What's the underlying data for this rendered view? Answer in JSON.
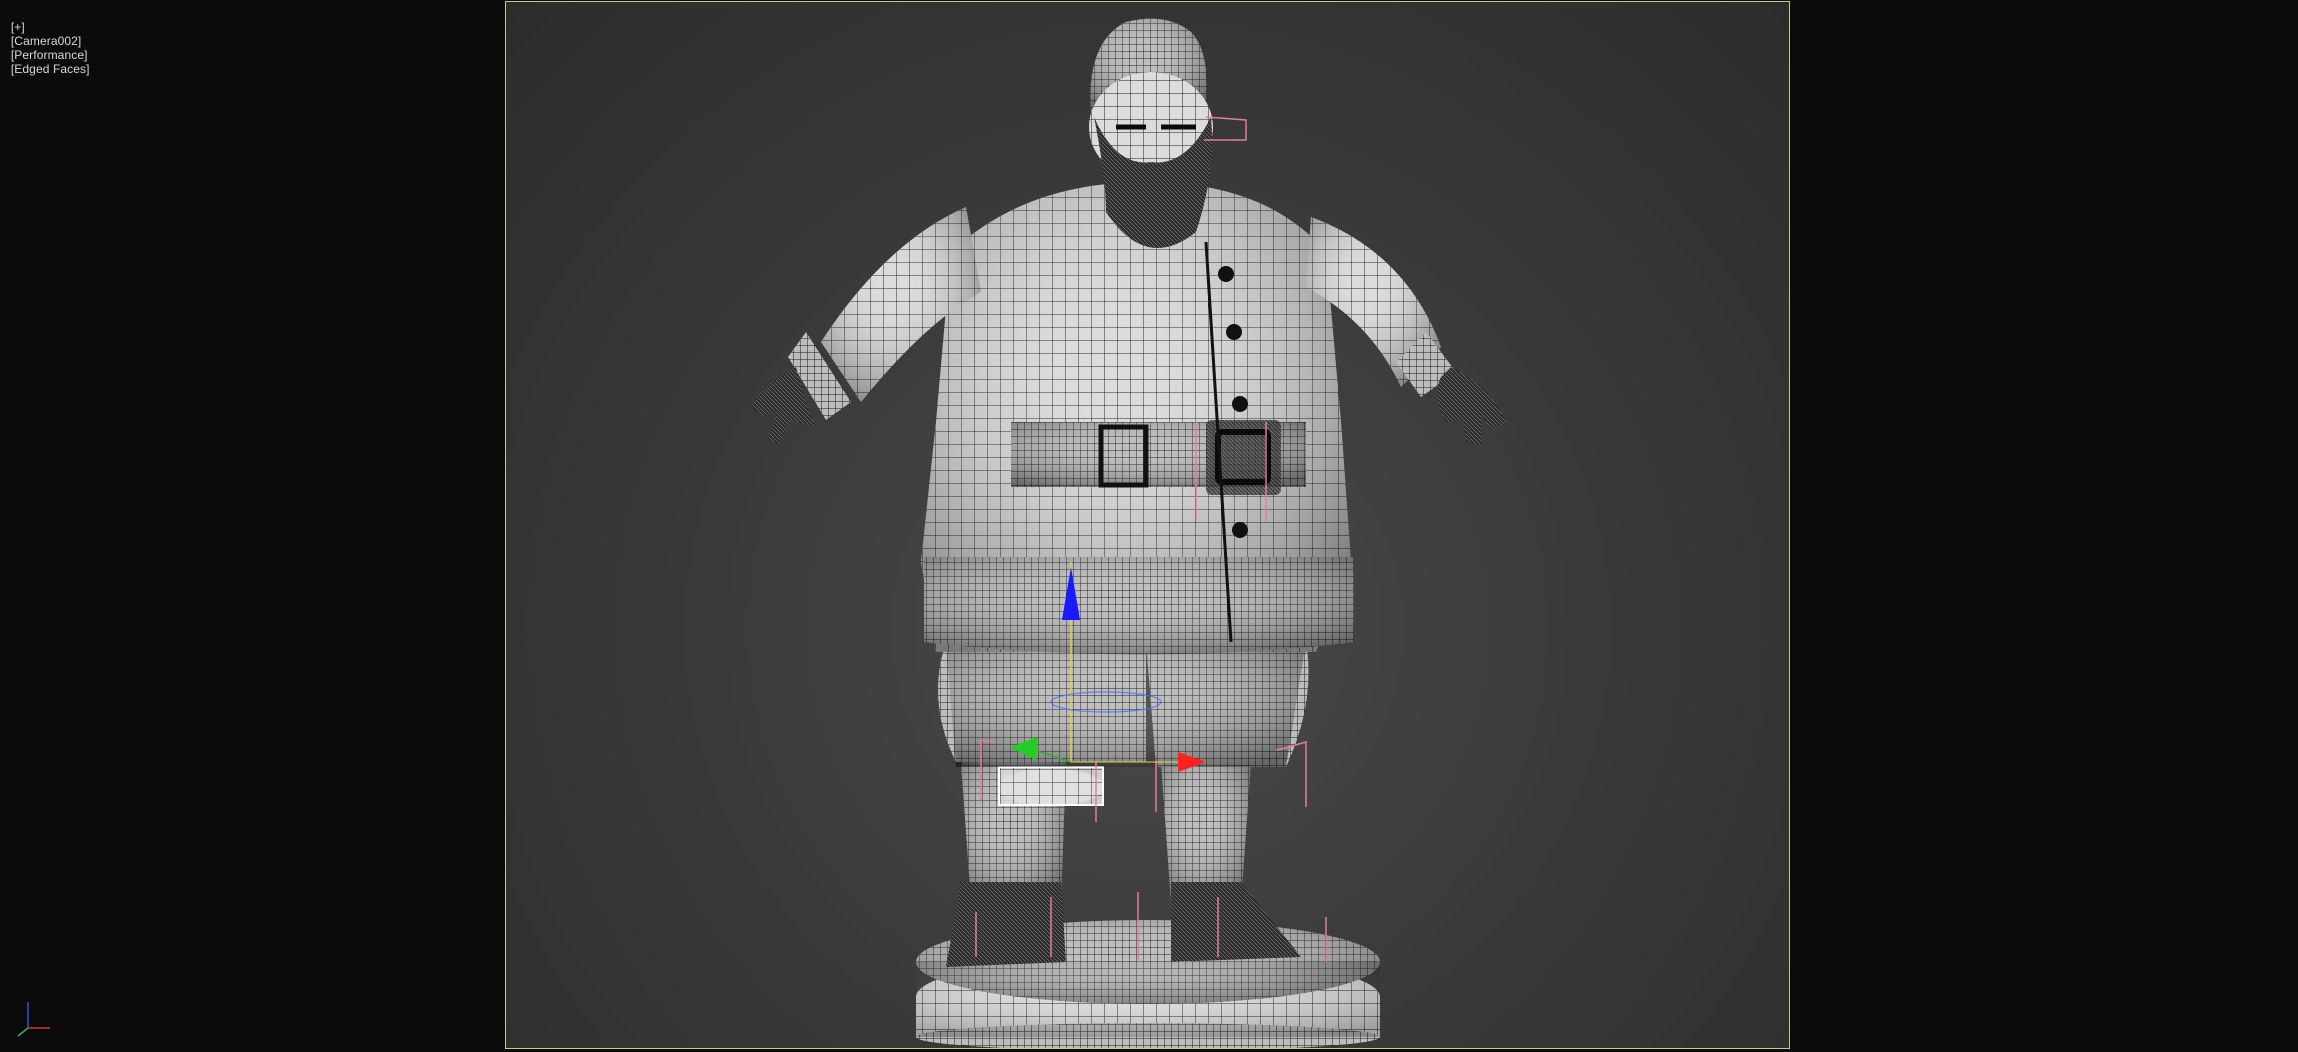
{
  "viewport": {
    "label_plus": "[+]",
    "label_camera": "[Camera002]",
    "label_shading": "[Performance]",
    "label_mode": "[Edged Faces]",
    "bg_color": "#3b3b3b",
    "safe_frame_color": "#cfc67a"
  },
  "gizmo": {
    "x_color": "#ff2020",
    "y_color": "#22cc22",
    "z_color": "#1a1aff"
  },
  "scene": {
    "object": "santa-claus-figurine",
    "wire_color": "#111111",
    "surface_color": "#e6e6e6"
  }
}
